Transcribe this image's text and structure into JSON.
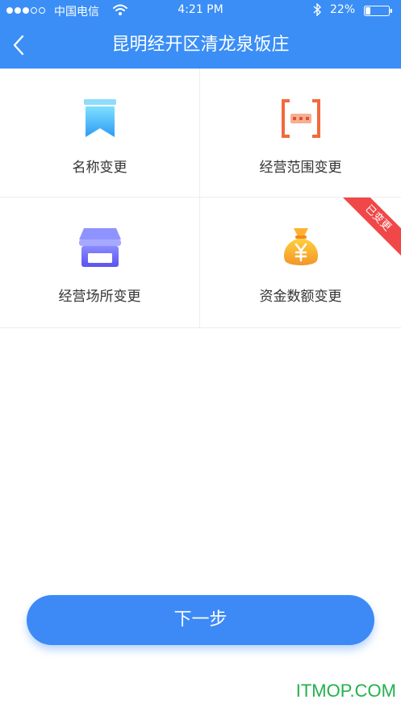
{
  "status_bar": {
    "carrier": "中国电信",
    "time": "4:21 PM",
    "battery_percent": "22%",
    "signal_dots": [
      "filled",
      "filled",
      "filled",
      "empty",
      "empty"
    ]
  },
  "nav": {
    "back_icon": "chevron-left-icon",
    "title": "昆明经开区清龙泉饭庄"
  },
  "options": [
    {
      "label": "名称变更",
      "icon": "bookmark-icon",
      "changed": false
    },
    {
      "label": "经营范围变更",
      "icon": "brackets-icon",
      "changed": false
    },
    {
      "label": "经营场所变更",
      "icon": "shop-icon",
      "changed": false
    },
    {
      "label": "资金数额变更",
      "icon": "money-bag-icon",
      "changed": true,
      "badge": "已变更"
    }
  ],
  "next_button": {
    "label": "下一步"
  },
  "watermark": "ITMOP.COM",
  "colors": {
    "primary": "#3a8ef6",
    "badge": "#f04848",
    "watermark": "#22b14c"
  }
}
